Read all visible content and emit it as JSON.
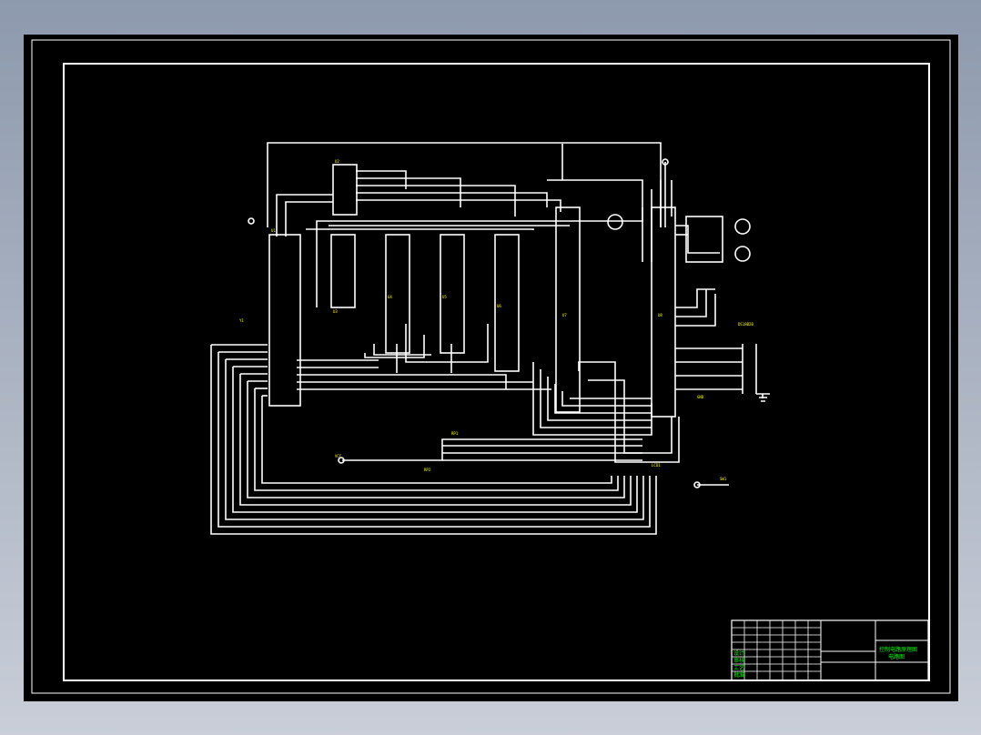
{
  "drawing": {
    "labels": {
      "u1": "U1",
      "u2": "U2",
      "u3": "U3",
      "u4": "U4",
      "u5": "U5",
      "u6": "U6",
      "u7": "U7",
      "u8": "U8",
      "rp1": "RP1",
      "rp2": "RP2",
      "lcd": "LCD1",
      "ds18b20": "DS18B20",
      "sw": "SW1",
      "y1": "Y1",
      "vcc": "VCC",
      "gnd": "GND"
    },
    "title_block": {
      "drawing_name": "控制电路原理图",
      "sheet": "电路图",
      "rows": [
        "设计",
        "审核",
        "工艺",
        "批准"
      ]
    }
  }
}
